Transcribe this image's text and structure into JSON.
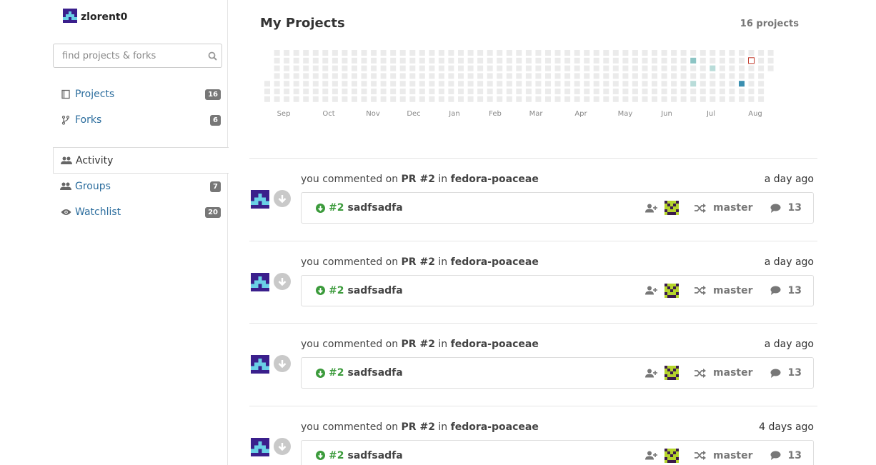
{
  "user": {
    "name": "zlorent0"
  },
  "search": {
    "placeholder": "find projects & forks"
  },
  "nav": {
    "projects": {
      "label": "Projects",
      "count": "16"
    },
    "forks": {
      "label": "Forks",
      "count": "6"
    },
    "activity": {
      "label": "Activity"
    },
    "groups": {
      "label": "Groups",
      "count": "7"
    },
    "watchlist": {
      "label": "Watchlist",
      "count": "20"
    }
  },
  "projects_panel": {
    "title": "My Projects",
    "count": "16 projects",
    "months": [
      "Sep",
      "Oct",
      "Nov",
      "Dec",
      "Jan",
      "Feb",
      "Mar",
      "Apr",
      "May",
      "Jun",
      "Jul",
      "Aug"
    ]
  },
  "activity": [
    {
      "actor": "you",
      "action": "commented on",
      "target": "PR #2",
      "in": "in",
      "repo": "fedora-poaceae",
      "time": "a day ago",
      "pr_number": "#2",
      "pr_title": "sadfsadfa",
      "branch": "master",
      "comments": "13"
    },
    {
      "actor": "you",
      "action": "commented on",
      "target": "PR #2",
      "in": "in",
      "repo": "fedora-poaceae",
      "time": "a day ago",
      "pr_number": "#2",
      "pr_title": "sadfsadfa",
      "branch": "master",
      "comments": "13"
    },
    {
      "actor": "you",
      "action": "commented on",
      "target": "PR #2",
      "in": "in",
      "repo": "fedora-poaceae",
      "time": "a day ago",
      "pr_number": "#2",
      "pr_title": "sadfsadfa",
      "branch": "master",
      "comments": "13"
    },
    {
      "actor": "you",
      "action": "commented on",
      "target": "PR #2",
      "in": "in",
      "repo": "fedora-poaceae",
      "time": "4 days ago",
      "pr_number": "#2",
      "pr_title": "sadfsadfa",
      "branch": "master",
      "comments": "13"
    }
  ],
  "colors": {
    "link": "#2d6e9e",
    "pr_green": "#3c9b3c",
    "heat_empty": "#ebebeb",
    "heat_1": "#b9dcd9",
    "heat_2": "#8cc4c4",
    "heat_3": "#3b8fb0",
    "heat_today": "#c0392b"
  }
}
